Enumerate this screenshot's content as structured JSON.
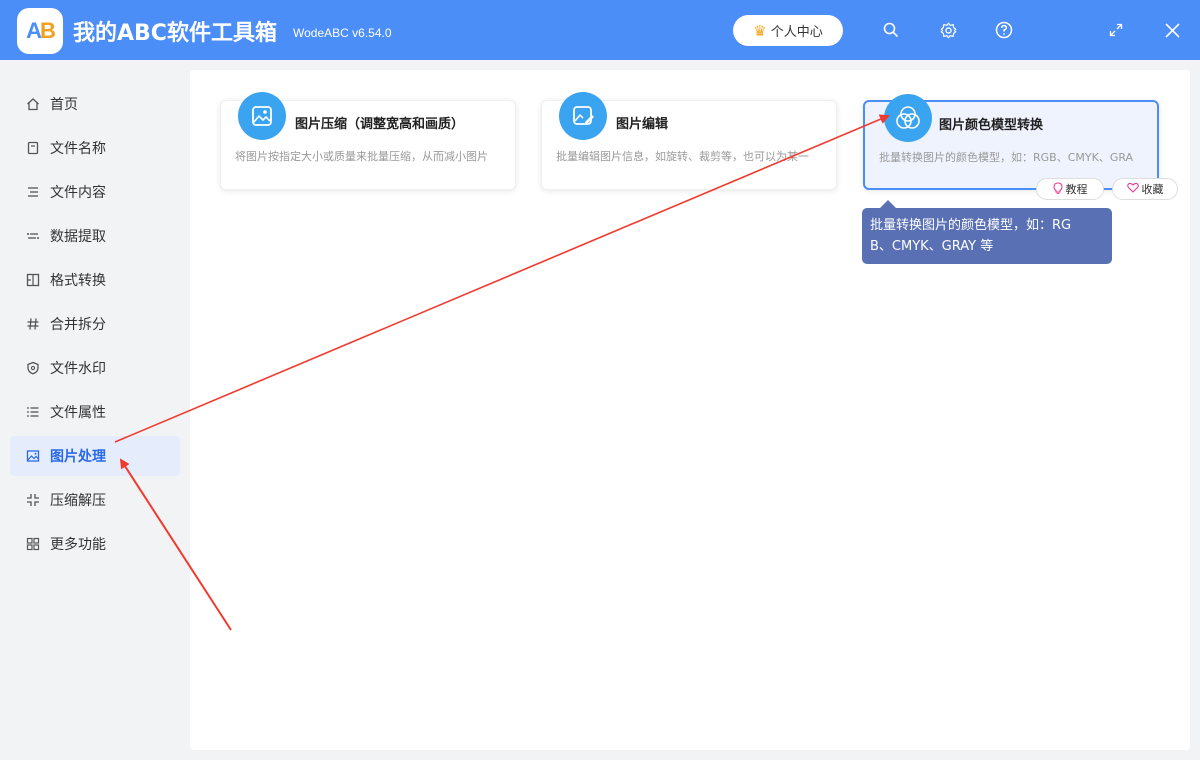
{
  "app": {
    "logo_a": "A",
    "logo_b": "B",
    "title": "我的ABC软件工具箱",
    "version": "WodeABC v6.54.0",
    "user_center": "个人中心",
    "brand_color": "#4c8ef7"
  },
  "titlebar_icons": [
    "search-icon",
    "gear-icon",
    "help-icon",
    "maximize-icon",
    "close-icon"
  ],
  "sidebar": {
    "items": [
      {
        "label": "首页",
        "icon": "home-icon"
      },
      {
        "label": "文件名称",
        "icon": "file-name-icon"
      },
      {
        "label": "文件内容",
        "icon": "file-content-icon"
      },
      {
        "label": "数据提取",
        "icon": "data-extract-icon"
      },
      {
        "label": "格式转换",
        "icon": "format-convert-icon"
      },
      {
        "label": "合并拆分",
        "icon": "merge-split-icon"
      },
      {
        "label": "文件水印",
        "icon": "watermark-icon"
      },
      {
        "label": "文件属性",
        "icon": "file-properties-icon"
      },
      {
        "label": "图片处理",
        "icon": "image-icon",
        "active": true
      },
      {
        "label": "压缩解压",
        "icon": "compress-icon"
      },
      {
        "label": "更多功能",
        "icon": "more-icon"
      }
    ]
  },
  "cards": [
    {
      "title": "图片压缩（调整宽高和画质）",
      "desc": "将图片按指定大小或质量来批量压缩，从而减小图片",
      "icon": "image-compress-icon"
    },
    {
      "title": "图片编辑",
      "desc": "批量编辑图片信息，如旋转、裁剪等，也可以为某一",
      "icon": "image-edit-icon"
    },
    {
      "title": "图片颜色模型转换",
      "desc": "批量转换图片的颜色模型，如：RGB、CMYK、GRA",
      "icon": "color-model-icon",
      "selected": true
    }
  ],
  "card_actions": {
    "tutorial": "教程",
    "favorite": "收藏"
  },
  "tooltip": {
    "line1": "批量转换图片的颜色模型，如：RG",
    "line2": "B、CMYK、GRAY 等"
  }
}
